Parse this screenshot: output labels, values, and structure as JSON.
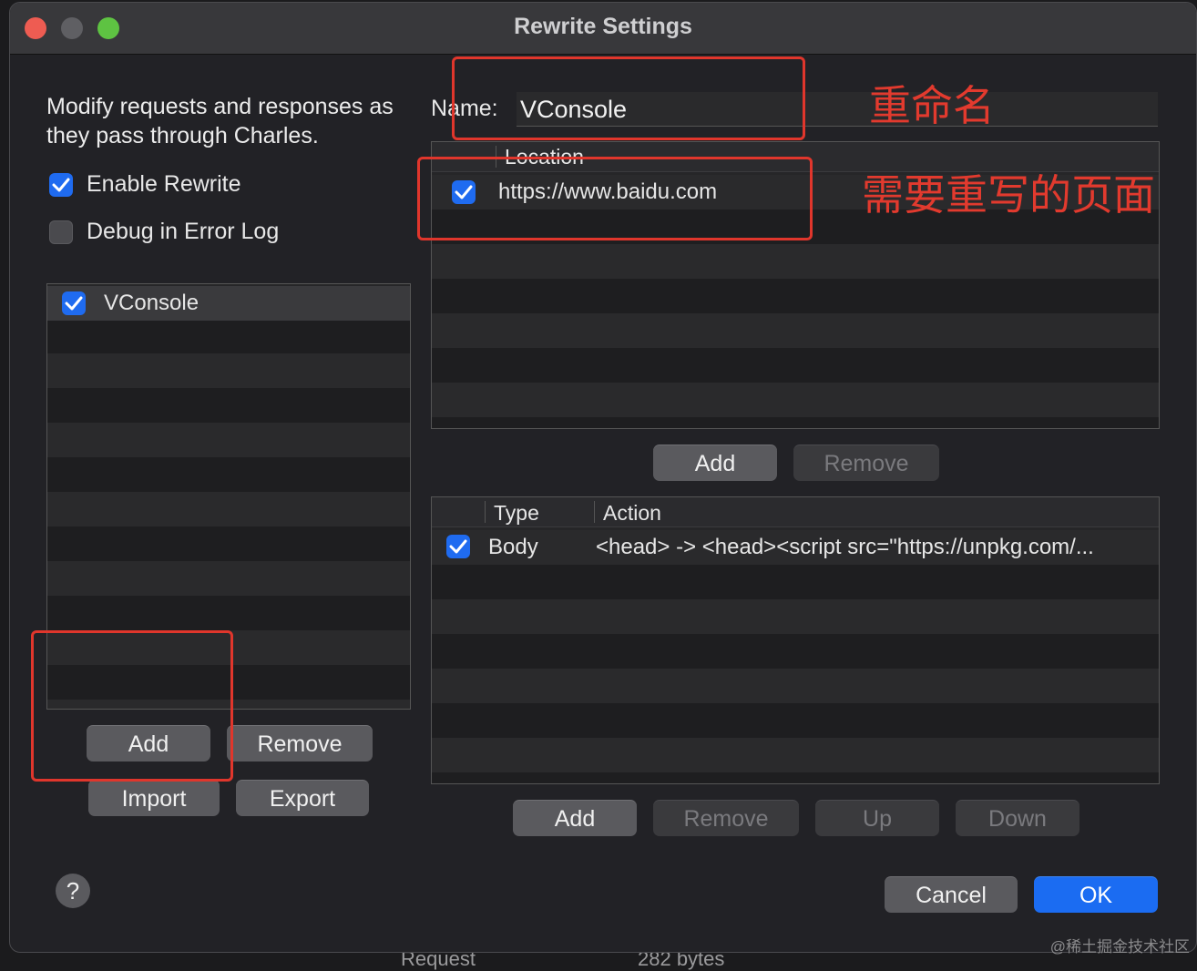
{
  "window": {
    "title": "Rewrite Settings"
  },
  "left": {
    "description": "Modify requests and responses as they pass through Charles.",
    "enable_rewrite": {
      "label": "Enable Rewrite",
      "checked": true
    },
    "debug_error_log": {
      "label": "Debug in Error Log",
      "checked": false
    },
    "sets": [
      {
        "name": "VConsole",
        "checked": true
      }
    ],
    "buttons": {
      "add": "Add",
      "remove": "Remove",
      "import": "Import",
      "export": "Export"
    }
  },
  "name_field": {
    "label": "Name:",
    "value": "VConsole"
  },
  "locations": {
    "header": "Location",
    "rows": [
      {
        "checked": true,
        "location": "https://www.baidu.com"
      }
    ],
    "buttons": {
      "add": "Add",
      "remove": "Remove"
    }
  },
  "rules": {
    "headers": {
      "type": "Type",
      "action": "Action"
    },
    "rows": [
      {
        "checked": true,
        "type": "Body",
        "action": "<head> -> <head><script src=\"https://unpkg.com/..."
      }
    ],
    "buttons": {
      "add": "Add",
      "remove": "Remove",
      "up": "Up",
      "down": "Down"
    }
  },
  "footer": {
    "help": "?",
    "cancel": "Cancel",
    "ok": "OK"
  },
  "annotations": {
    "rename": "重命名",
    "pages": "需要重写的页面"
  },
  "background": {
    "request": "Request",
    "bytes": "282 bytes"
  },
  "watermark": "@稀土掘金技术社区",
  "colors": {
    "accent": "#1b6cf2",
    "annotation": "#e23a2e"
  }
}
